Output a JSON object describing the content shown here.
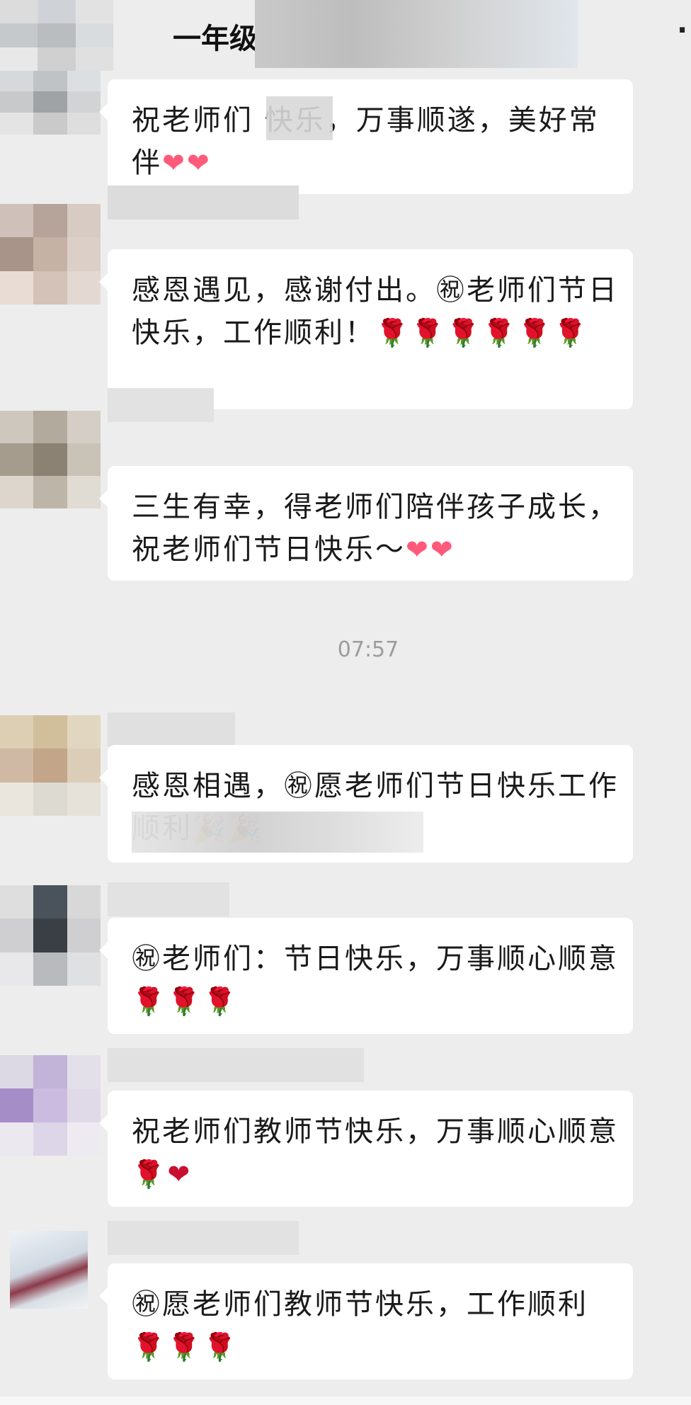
{
  "header": {
    "title": "一年级",
    "more_icon": "·"
  },
  "timestamp": "07:57",
  "messages": [
    {
      "text": "祝老师们 快乐，万事顺遂，美好常伴",
      "emoji": "❤❤"
    },
    {
      "text": "感恩遇见，感谢付出。㊗老师们节日快乐，工作顺利！",
      "emoji": "🌹🌹🌹🌹🌹🌹"
    },
    {
      "text": "三生有幸，得老师们陪伴孩子成长，祝老师们节日快乐～",
      "emoji": "❤❤"
    },
    {
      "text": "感恩相遇，㊗愿老师们节日快乐工作顺利",
      "emoji": "🎉🎉"
    },
    {
      "text": "㊗老师们：节日快乐，万事顺心顺意",
      "emoji": "🌹🌹🌹"
    },
    {
      "text": "祝老师们教师节快乐，万事顺心顺意",
      "emoji": "🌹❤"
    },
    {
      "text": "㊗愿老师们教师节快乐，工作顺利",
      "emoji": "🌹🌹🌹"
    }
  ],
  "icons": {
    "rose": "rose-icon",
    "heart": "heart-icon",
    "congrats": "congratulation-icon",
    "party": "party-popper-icon"
  },
  "colors": {
    "background": "#ededed",
    "bubble": "#ffffff",
    "text": "#1a1a1a",
    "timestamp": "#9c9c9c"
  }
}
